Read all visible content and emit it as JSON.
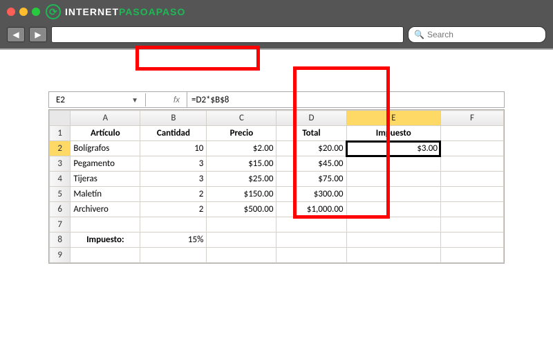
{
  "browser": {
    "logo_white": "INTERNET",
    "logo_green": "PASOAPASO",
    "search_placeholder": "Search"
  },
  "excel": {
    "name_box": "E2",
    "fx_label": "fx",
    "formula": "=D2*$B$8",
    "columns": [
      "A",
      "B",
      "C",
      "D",
      "E",
      "F"
    ],
    "selected_col": "E",
    "selected_row": "2",
    "headers": {
      "articulo": "Artículo",
      "cantidad": "Cantidad",
      "precio": "Precio",
      "total": "Total",
      "impuesto": "Impuesto"
    },
    "rows": [
      {
        "n": "1"
      },
      {
        "n": "2",
        "a": "Bolígrafos",
        "b": "10",
        "c": "$2.00",
        "d": "$20.00",
        "e": "$3.00"
      },
      {
        "n": "3",
        "a": "Pegamento",
        "b": "3",
        "c": "$15.00",
        "d": "$45.00",
        "e": ""
      },
      {
        "n": "4",
        "a": "Tijeras",
        "b": "3",
        "c": "$25.00",
        "d": "$75.00",
        "e": ""
      },
      {
        "n": "5",
        "a": "Maletín",
        "b": "2",
        "c": "$150.00",
        "d": "$300.00",
        "e": ""
      },
      {
        "n": "6",
        "a": "Archivero",
        "b": "2",
        "c": "$500.00",
        "d": "$1,000.00",
        "e": ""
      },
      {
        "n": "7"
      },
      {
        "n": "8",
        "a": "Impuesto:",
        "b": "15%"
      },
      {
        "n": "9"
      }
    ]
  },
  "chart_data": {
    "type": "table",
    "title": "",
    "columns": [
      "Artículo",
      "Cantidad",
      "Precio",
      "Total",
      "Impuesto"
    ],
    "rows": [
      [
        "Bolígrafos",
        10,
        2.0,
        20.0,
        3.0
      ],
      [
        "Pegamento",
        3,
        15.0,
        45.0,
        null
      ],
      [
        "Tijeras",
        3,
        25.0,
        75.0,
        null
      ],
      [
        "Maletín",
        2,
        150.0,
        300.0,
        null
      ],
      [
        "Archivero",
        2,
        500.0,
        1000.0,
        null
      ]
    ],
    "footer": {
      "Impuesto": "15%"
    },
    "formula_shown": "=D2*$B$8"
  }
}
